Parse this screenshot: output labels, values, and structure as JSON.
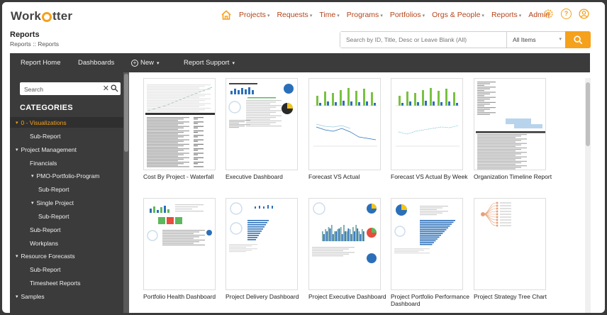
{
  "app": {
    "logo_prefix": "Work",
    "logo_suffix": "tter"
  },
  "nav": {
    "items": [
      "Projects",
      "Requests",
      "Time",
      "Programs",
      "Portfolios",
      "Orgs & People",
      "Reports"
    ],
    "admin": "Admin"
  },
  "header": {
    "title": "Reports",
    "breadcrumb": "Reports :: Reports",
    "search_placeholder": "Search by ID, Title, Desc or Leave Blank (All)",
    "filter_selected": "All Items"
  },
  "toolbar": {
    "home": "Report Home",
    "dashboards": "Dashboards",
    "new": "New",
    "support": "Report Support"
  },
  "sidebar": {
    "search_placeholder": "Search",
    "categories_title": "CATEGORIES",
    "items": [
      {
        "label": "0 - Visualizations",
        "caret": "▾"
      },
      {
        "label": "Sub-Report",
        "caret": ""
      },
      {
        "label": "Project Management",
        "caret": "▾"
      },
      {
        "label": "Financials",
        "caret": ""
      },
      {
        "label": "PMO-Portfolio-Program",
        "caret": "▾"
      },
      {
        "label": "Sub-Report",
        "caret": ""
      },
      {
        "label": "Single Project",
        "caret": "▾"
      },
      {
        "label": "Sub-Report",
        "caret": ""
      },
      {
        "label": "Sub-Report",
        "caret": ""
      },
      {
        "label": "Workplans",
        "caret": ""
      },
      {
        "label": "Resource Forecasts",
        "caret": "▾"
      },
      {
        "label": "Sub-Report",
        "caret": ""
      },
      {
        "label": "Timesheet Reports",
        "caret": ""
      },
      {
        "label": "Samples",
        "caret": "▾"
      }
    ]
  },
  "reports": [
    {
      "title": "Cost By Project - Waterfall"
    },
    {
      "title": "Executive Dashboard"
    },
    {
      "title": "Forecast VS Actual"
    },
    {
      "title": "Forecast VS Actual By Week"
    },
    {
      "title": "Organization Timeline Report"
    },
    {
      "title": "Portfolio Health Dashboard"
    },
    {
      "title": "Project Delivery Dashboard"
    },
    {
      "title": "Project Executive Dashboard"
    },
    {
      "title": "Project Portfolio Performance Dashboard"
    },
    {
      "title": "Project Strategy Tree Chart"
    }
  ],
  "colors": {
    "accent": "#f5a11c",
    "toolbar": "#3b3b3b",
    "nav_text": "#b5451b"
  }
}
